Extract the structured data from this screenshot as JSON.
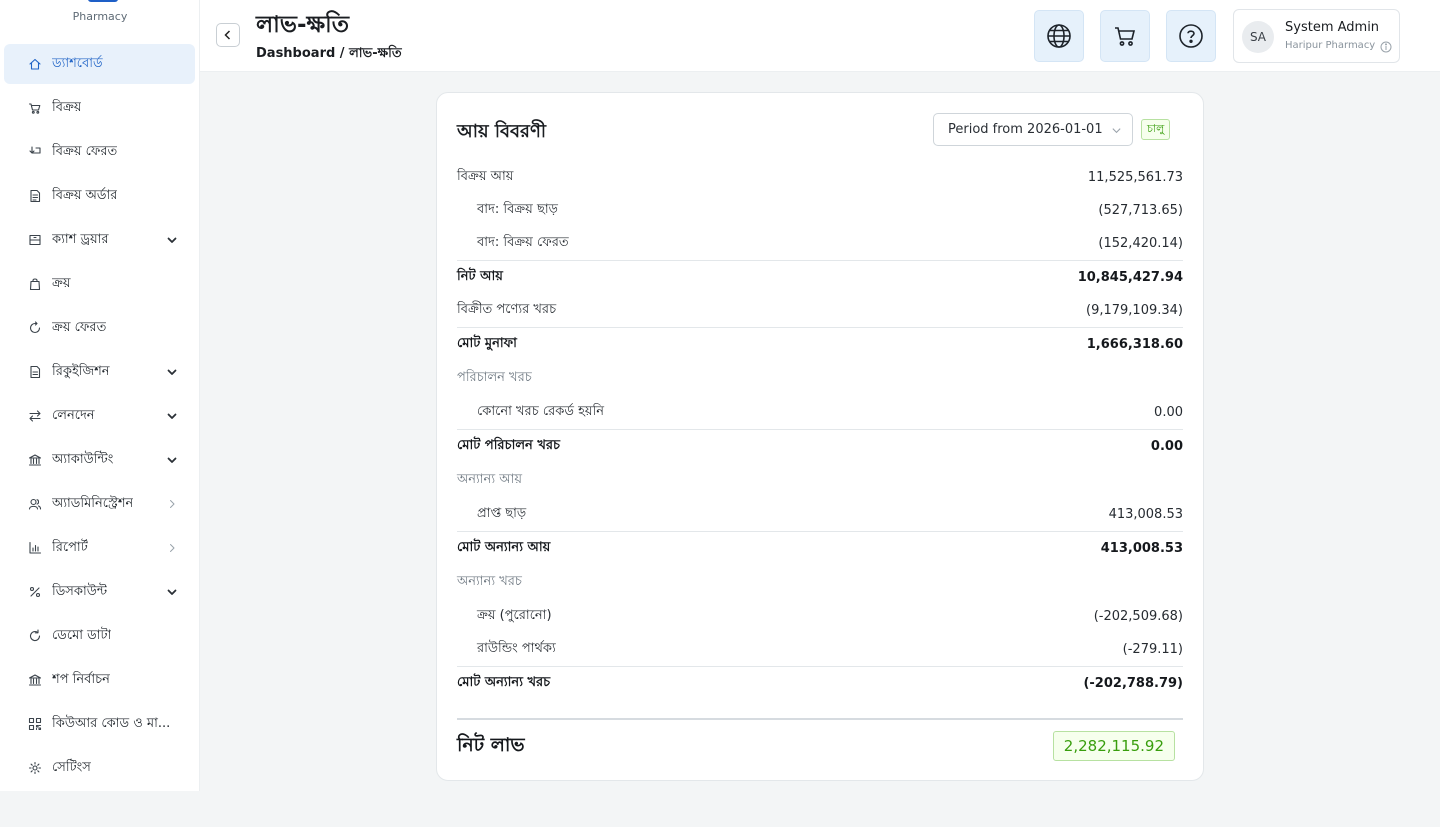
{
  "brand": {
    "subtitle": "Pharmacy",
    "accent": "#1e5fc7"
  },
  "sidebar": {
    "items": [
      {
        "label": "ড্যাশবোর্ড",
        "icon": "home-icon",
        "active": true
      },
      {
        "label": "বিক্রয়",
        "icon": "cart-icon"
      },
      {
        "label": "বিক্রয় ফেরত",
        "icon": "return-icon"
      },
      {
        "label": "বিক্রয় অর্ডার",
        "icon": "document-icon"
      },
      {
        "label": "ক্যাশ ড্রয়ার",
        "icon": "drawer-icon",
        "arrow": "chevron-down-icon"
      },
      {
        "label": "ক্রয়",
        "icon": "bag-icon"
      },
      {
        "label": "ক্রয় ফেরত",
        "icon": "undo-icon"
      },
      {
        "label": "রিকুইজিশন",
        "icon": "file-icon",
        "arrow": "chevron-down-icon"
      },
      {
        "label": "লেনদেন",
        "icon": "swap-icon",
        "arrow": "chevron-down-icon"
      },
      {
        "label": "অ্যাকাউন্টিং",
        "icon": "bank-icon",
        "arrow": "chevron-down-icon"
      },
      {
        "label": "অ্যাডমিনিস্ট্রেশন",
        "icon": "users-icon",
        "arrow": "chevron-right-icon"
      },
      {
        "label": "রিপোর্ট",
        "icon": "bar-chart-icon",
        "arrow": "chevron-right-icon"
      },
      {
        "label": "ডিসকাউন্ট",
        "icon": "percent-icon",
        "arrow": "chevron-down-icon"
      },
      {
        "label": "ডেমো ডাটা",
        "icon": "reload-icon"
      },
      {
        "label": "শপ নির্বাচন",
        "icon": "shop-icon"
      },
      {
        "label": "কিউআর কোড ও মা...",
        "icon": "qrcode-icon"
      },
      {
        "label": "সেটিংস",
        "icon": "gear-icon"
      }
    ]
  },
  "header": {
    "title": "লাভ-ক্ষতি",
    "breadcrumb": "Dashboard / লাভ-ক্ষতি",
    "buttons": [
      "globe-icon",
      "cart-icon",
      "help-icon"
    ],
    "user": {
      "initials": "SA",
      "name": "System Admin",
      "org": "Haripur Pharmacy"
    }
  },
  "report": {
    "title": "আয় বিবরণী",
    "period": "Period from 2026-01-01",
    "status": "চালু",
    "rows": [
      {
        "label": "বিক্রয় আয়",
        "value": "11,525,561.73",
        "kind": "normal"
      },
      {
        "label": "বাদ: বিক্রয় ছাড়",
        "value": "(527,713.65)",
        "kind": "indent"
      },
      {
        "label": "বাদ: বিক্রয় ফেরত",
        "value": "(152,420.14)",
        "kind": "indent"
      },
      {
        "label": "নিট আয়",
        "value": "10,845,427.94",
        "kind": "total"
      },
      {
        "label": "বিক্রীত পণ্যের খরচ",
        "value": "(9,179,109.34)",
        "kind": "normal"
      },
      {
        "label": "মোট মুনাফা",
        "value": "1,666,318.60",
        "kind": "total"
      },
      {
        "label": "পরিচালন খরচ",
        "value": "",
        "kind": "section"
      },
      {
        "label": "কোনো খরচ রেকর্ড হয়নি",
        "value": "0.00",
        "kind": "indent"
      },
      {
        "label": "মোট পরিচালন খরচ",
        "value": "0.00",
        "kind": "total"
      },
      {
        "label": "অন্যান্য আয়",
        "value": "",
        "kind": "section"
      },
      {
        "label": "প্রাপ্ত ছাড়",
        "value": "413,008.53",
        "kind": "indent"
      },
      {
        "label": "মোট অন্যান্য আয়",
        "value": "413,008.53",
        "kind": "total"
      },
      {
        "label": "অন্যান্য খরচ",
        "value": "",
        "kind": "section"
      },
      {
        "label": "ক্রয় (পুরোনো)",
        "value": "(-202,509.68)",
        "kind": "indent"
      },
      {
        "label": "রাউন্ডিং পার্থক্য",
        "value": "(-279.11)",
        "kind": "indent"
      },
      {
        "label": "মোট অন্যান্য খরচ",
        "value": "(-202,788.79)",
        "kind": "total"
      }
    ],
    "net": {
      "label": "নিট লাভ",
      "value": "2,282,115.92"
    }
  }
}
